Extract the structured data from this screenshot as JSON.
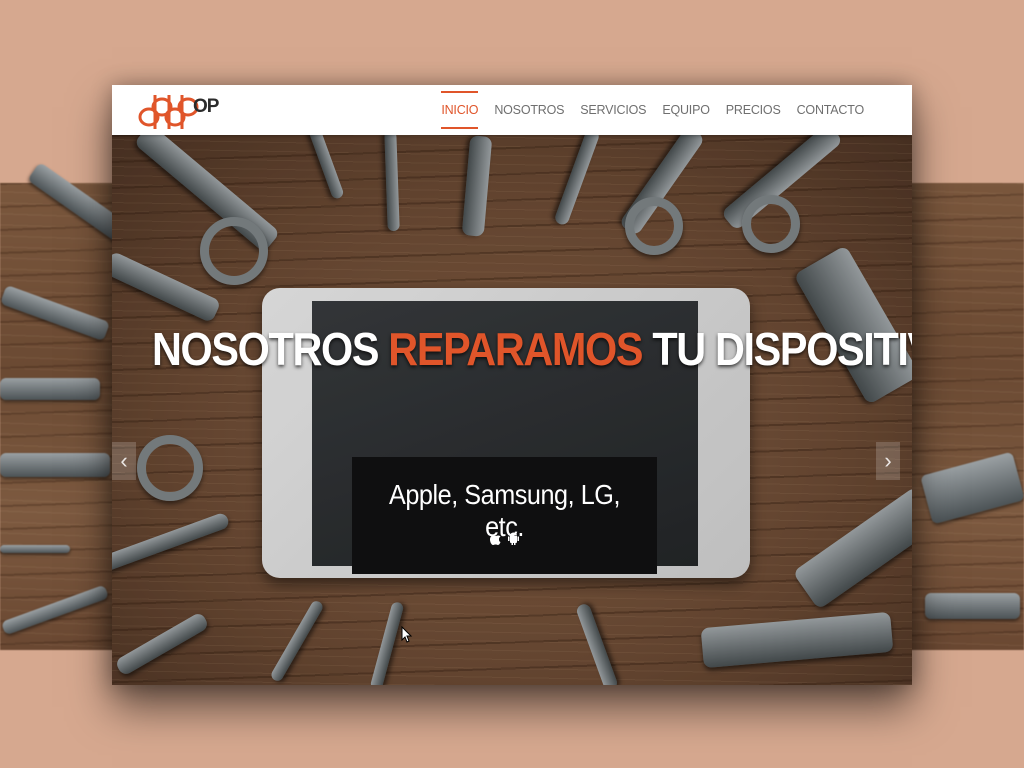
{
  "brand": {
    "text": "OP",
    "accent": "#e0552a"
  },
  "nav": [
    {
      "label": "INICIO",
      "active": true
    },
    {
      "label": "NOSOTROS",
      "active": false
    },
    {
      "label": "SERVICIOS",
      "active": false
    },
    {
      "label": "EQUIPO",
      "active": false
    },
    {
      "label": "PRECIOS",
      "active": false
    },
    {
      "label": "CONTACTO",
      "active": false
    }
  ],
  "hero": {
    "title_part1": "NOSOTROS ",
    "title_accent": "REPARAMOS",
    "title_part2": " TU DISPOSITIVO",
    "subtitle": "Apple, Samsung, LG, etc.",
    "platform_icons": [
      "apple-icon",
      "android-icon"
    ]
  },
  "carousel": {
    "prev_label": "‹",
    "next_label": "›",
    "slide_count": 3,
    "active_slide": 1
  }
}
